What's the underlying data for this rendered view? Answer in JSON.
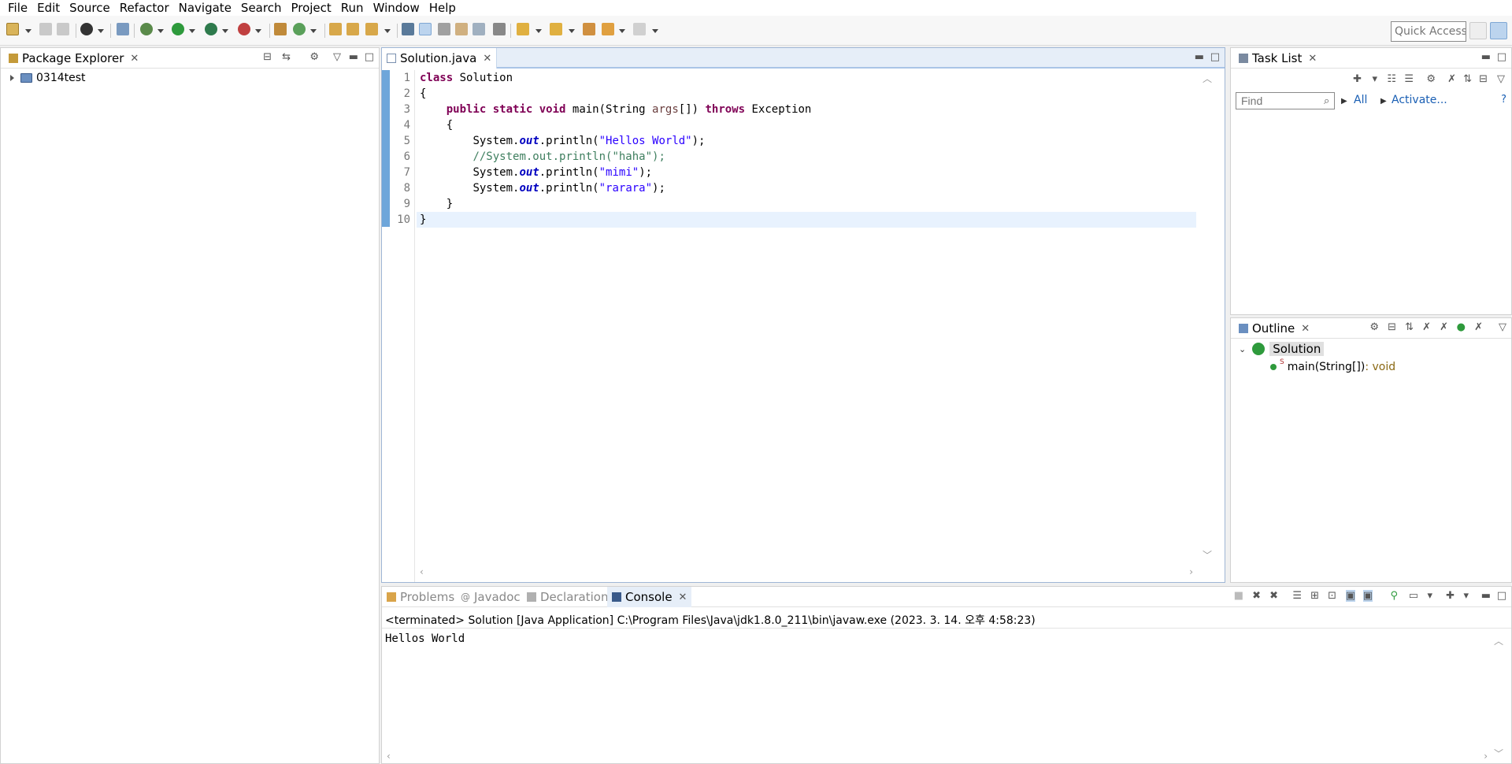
{
  "menu": [
    "File",
    "Edit",
    "Source",
    "Refactor",
    "Navigate",
    "Search",
    "Project",
    "Run",
    "Window",
    "Help"
  ],
  "toolbar": {
    "quick_access_placeholder": "Quick Access"
  },
  "package_explorer": {
    "title": "Package Explorer",
    "items": [
      {
        "label": "0314test"
      }
    ]
  },
  "editor": {
    "tab_title": "Solution.java",
    "line_numbers": [
      "1",
      "2",
      "3",
      "4",
      "5",
      "6",
      "7",
      "8",
      "9",
      "10"
    ],
    "code": {
      "l1a": "class",
      "l1b": " Solution",
      "l2": "{",
      "l3a": "public",
      "l3b": "static",
      "l3c": "void",
      "l3d": " main(String ",
      "l3e": "args",
      "l3f": "[]) ",
      "l3g": "throws",
      "l3h": " Exception",
      "l4": "{",
      "l5a": "System.",
      "l5b": "out",
      "l5c": ".println(",
      "l5d": "\"Hellos World\"",
      "l5e": ");",
      "l6": "//System.out.println(\"haha\");",
      "l7a": "System.",
      "l7b": "out",
      "l7c": ".println(",
      "l7d": "\"mimi\"",
      "l7e": ");",
      "l8a": "System.",
      "l8b": "out",
      "l8c": ".println(",
      "l8d": "\"rarara\"",
      "l8e": ");",
      "l9": "}",
      "l10": "}"
    }
  },
  "task_list": {
    "title": "Task List",
    "find_placeholder": "Find",
    "all_label": "All",
    "activate_label": "Activate..."
  },
  "outline": {
    "title": "Outline",
    "class_name": "Solution",
    "method": "main(String[])",
    "method_type": " : void",
    "static_marker": "S"
  },
  "console": {
    "tabs": [
      "Problems",
      "Javadoc",
      "Declaration",
      "Console"
    ],
    "terminated": "<terminated> Solution [Java Application] C:\\Program Files\\Java\\jdk1.8.0_211\\bin\\javaw.exe (2023. 3. 14. 오후 4:58:23)",
    "output": "Hellos World"
  },
  "colors": {
    "keyword": "#7f0055",
    "string": "#2a00ff",
    "comment": "#3f7f5f",
    "field": "#0000c0",
    "link": "#1a5fb4",
    "active_tab": "#e6eef8"
  }
}
